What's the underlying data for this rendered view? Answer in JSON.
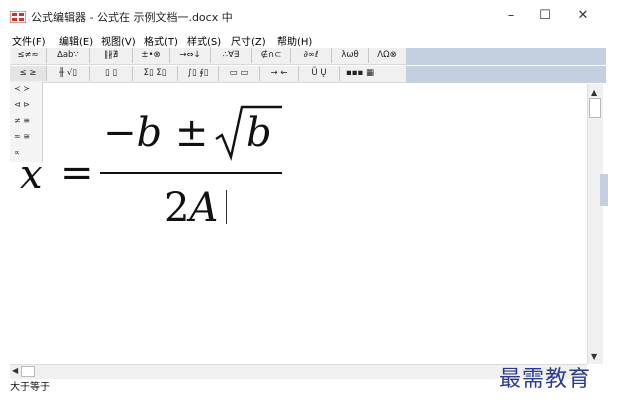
{
  "window": {
    "title": "公式编辑器 - 公式在 示例文档一.docx 中",
    "controls": {
      "minimize": "–",
      "maximize": "☐",
      "close": "✕"
    }
  },
  "menu": [
    "文件(F)",
    "编辑(E)",
    "视图(V)",
    "格式(T)",
    "样式(S)",
    "尺寸(Z)",
    "帮助(H)"
  ],
  "toolbar_row1": [
    "≤≠≈",
    "∆ab∵",
    "∥∦∄",
    "±•⊗",
    "→⇔↓",
    "∴∀∃",
    "∉∩⊂",
    "∂∞ℓ",
    "λωθ",
    "ΛΩ⊗"
  ],
  "toolbar_row2": [
    "≤ ≥",
    "╫ √▯",
    "▯ ▯",
    "Σ▯ Σ▯",
    "∫▯ ∮▯",
    "▭ ▭",
    "→ ←",
    "Ũ Ų",
    "▪▪▪ ▦"
  ],
  "palette": [
    "≺ ≻",
    "⊲ ⊳",
    "≠ ≡",
    "≈ ≅",
    "∝"
  ],
  "equation": {
    "lhs": "x",
    "equals": "=",
    "num_minus": "−",
    "num_b": "b",
    "num_pm": "±",
    "num_sqrt_arg": "b",
    "den_2": "2",
    "den_A": "A"
  },
  "status": "大于等于",
  "watermark": "最需教育"
}
